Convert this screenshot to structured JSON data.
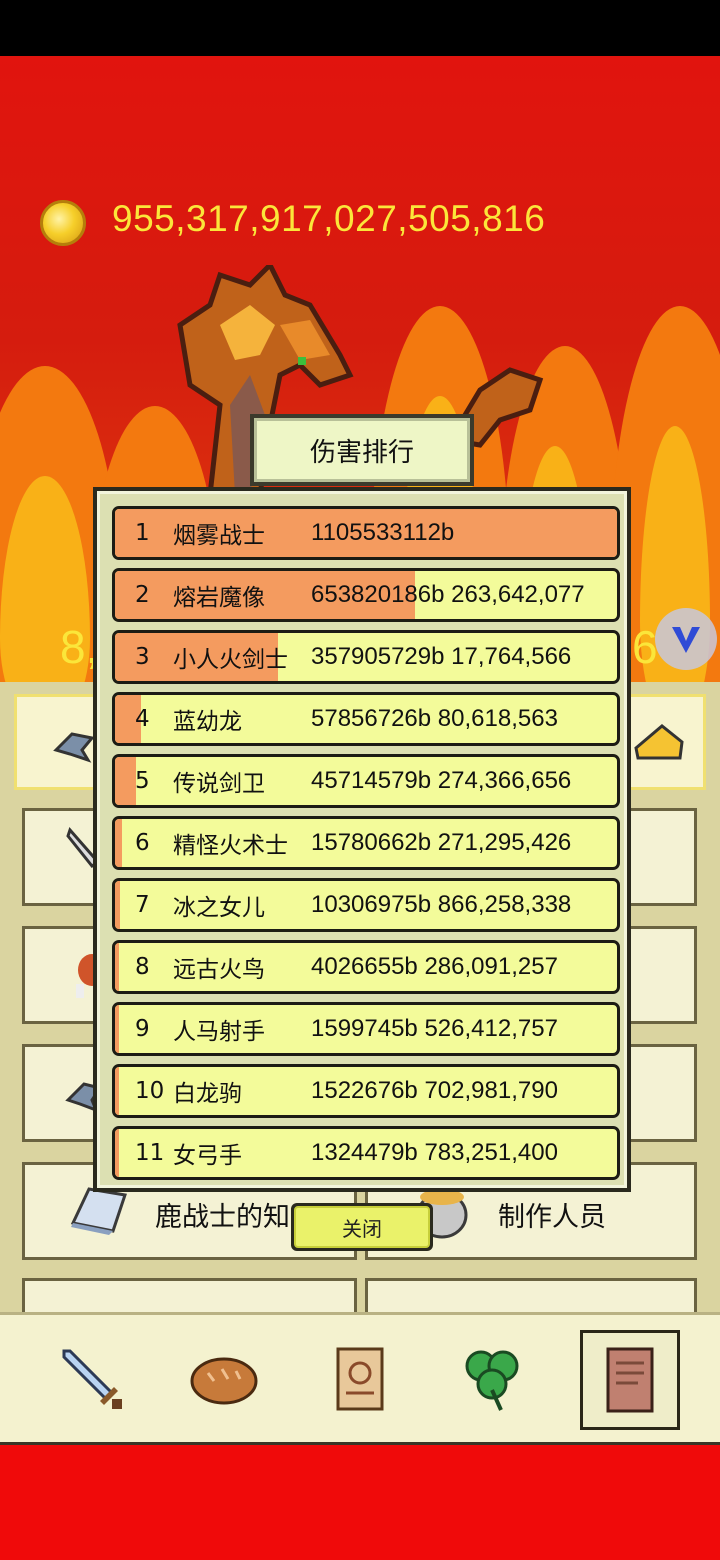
{
  "header": {
    "gold": "955,317,917,027,505,816",
    "hp_left_fragment": "8,",
    "hp_right_fragment": "6"
  },
  "menu": {
    "deer_knowledge_label": "鹿战士的知识",
    "credits_label": "制作人员"
  },
  "nav": {
    "items": [
      "sword-icon",
      "bread-icon",
      "scroll-icon",
      "clover-icon",
      "book-icon"
    ],
    "active_index": 4
  },
  "modal": {
    "title": "伤害排行",
    "close_label": "关闭",
    "rows": [
      {
        "rank": "1",
        "name": "烟雾战士",
        "damage": "1105533112b",
        "extra": "",
        "fill": 1.0
      },
      {
        "rank": "2",
        "name": "熔岩魔像",
        "damage": "65382018",
        "extra": "6b 263,642,077",
        "fill": 0.59
      },
      {
        "rank": "3",
        "name": "小人火剑士",
        "damage": "357905729b 17,764,566",
        "extra": "",
        "fill": 0.32
      },
      {
        "rank": "4",
        "name": "蓝幼龙",
        "damage": "57856726b 80,618,563",
        "extra": "",
        "fill": 0.052
      },
      {
        "rank": "5",
        "name": "传说剑卫",
        "damage": "45714579b 274,366,656",
        "extra": "",
        "fill": 0.041
      },
      {
        "rank": "6",
        "name": "精怪火术士",
        "damage": "15780662b 271,295,426",
        "extra": "",
        "fill": 0.014
      },
      {
        "rank": "7",
        "name": "冰之女儿",
        "damage": "10306975b 866,258,338",
        "extra": "",
        "fill": 0.009
      },
      {
        "rank": "8",
        "name": "远古火鸟",
        "damage": "4026655b 286,091,257",
        "extra": "",
        "fill": 0.004
      },
      {
        "rank": "9",
        "name": "人马射手",
        "damage": "1599745b 526,412,757",
        "extra": "",
        "fill": 0.0014
      },
      {
        "rank": "10",
        "name": "白龙驹",
        "damage": "1522676b 702,981,790",
        "extra": "",
        "fill": 0.0014
      },
      {
        "rank": "11",
        "name": "女弓手",
        "damage": "1324479b 783,251,400",
        "extra": "",
        "fill": 0.0012
      }
    ]
  },
  "colors": {
    "bar_fill": "#f49b5f",
    "row_bg": "#f3fb9a",
    "gold_text": "#fbe63a"
  }
}
